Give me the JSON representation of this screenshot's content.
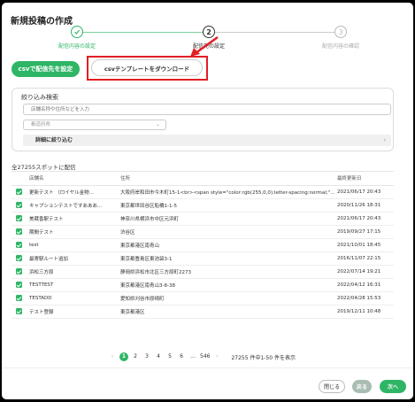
{
  "dialog": {
    "title": "新規投稿の作成"
  },
  "stepper": {
    "steps": [
      {
        "number": "",
        "label": "配信内容の設定"
      },
      {
        "number": "2",
        "label": "配信先の設定"
      },
      {
        "number": "3",
        "label": "配信内容の確認"
      }
    ]
  },
  "actions": {
    "csv_button": "csvで配信先を設定",
    "template_button": "csvテンプレートをダウンロード"
  },
  "filter": {
    "title": "絞り込み検索",
    "search_placeholder": "店舗名称や住所などを入力",
    "prefecture_placeholder": "都道府県",
    "advanced_label": "詳細に絞り込む"
  },
  "summary": "全27255スポットに配信",
  "table": {
    "headers": [
      "店舗名",
      "住所",
      "最終更新日"
    ],
    "rows": [
      {
        "name": "更新テスト （ロイヤル金物…",
        "address": "大阪府岸和田市今木町15-1<br><span style=\"color:rgb(255,0,0);letter-spacing:normal;\">...",
        "updated": "2021/06/17 20:43"
      },
      {
        "name": "キャプションテストですあああ…",
        "address": "東京都世田谷区船橋1-1-5",
        "updated": "2020/11/26 18:31"
      },
      {
        "name": "美蔵香駅テスト",
        "address": "神奈川県横浜市中区元浜町",
        "updated": "2021/06/17 20:43"
      },
      {
        "name": "期間テスト",
        "address": "渋谷区",
        "updated": "2019/09/27 17:15"
      },
      {
        "name": "test",
        "address": "東京都港区南青山",
        "updated": "2021/10/01 18:45"
      },
      {
        "name": "最寄駅ルート追加",
        "address": "東京都豊島区東池袋3-1",
        "updated": "2016/11/07 22:15"
      },
      {
        "name": "浜松三方原",
        "address": "静岡県浜松市北区三方原町2273",
        "updated": "2022/07/14 19:21"
      },
      {
        "name": "TESTTEST",
        "address": "東京都港区南青山3-8-38",
        "updated": "2022/04/12 16:31"
      },
      {
        "name": "TESTADD",
        "address": "愛知県刈谷市原崎町",
        "updated": "2022/04/28 15:53"
      },
      {
        "name": "テスト登録",
        "address": "東京都港区",
        "updated": "2019/12/11 10:48"
      }
    ]
  },
  "pagination": {
    "prev": "‹",
    "pages": [
      "1",
      "2",
      "3",
      "4",
      "5",
      "6",
      "...",
      "546"
    ],
    "next": "›",
    "current": "1",
    "info": "27255 件中1-50 件を表示"
  },
  "footer": {
    "close": "閉じる",
    "back": "戻る",
    "next": "次へ"
  },
  "colors": {
    "accent": "#2eb566",
    "highlight": "#e31e24"
  },
  "icons": {
    "step_done": "check-icon",
    "checkbox": "checkbox-checked-icon",
    "advanced": "chevron-right-icon",
    "select": "chevron-down-icon"
  }
}
